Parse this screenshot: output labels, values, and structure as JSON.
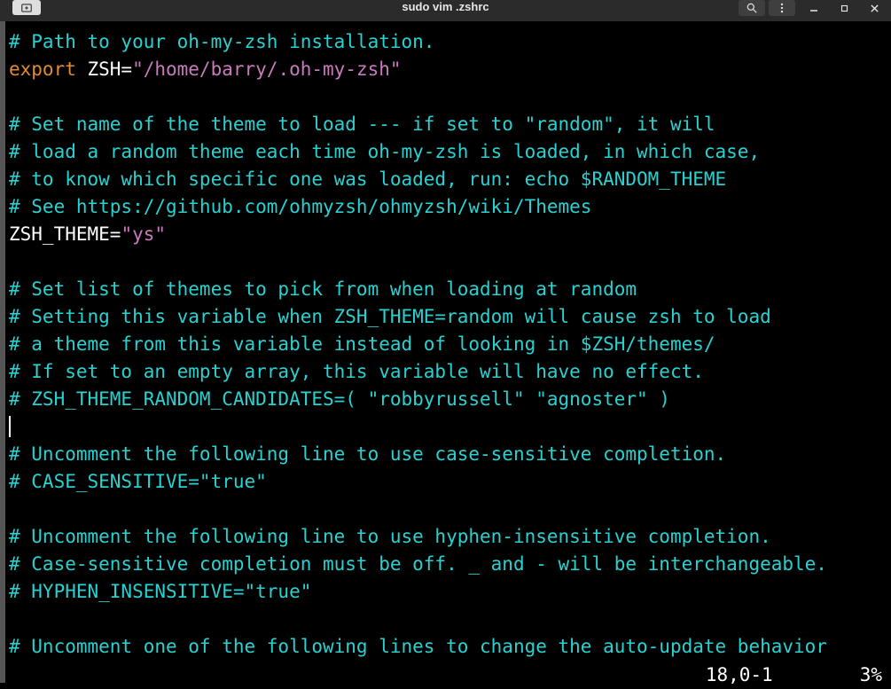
{
  "titlebar": {
    "title": "sudo vim .zshrc"
  },
  "editor": {
    "lines": [
      {
        "segments": [
          {
            "cls": "comment",
            "text": "# Path to your oh-my-zsh installation."
          }
        ]
      },
      {
        "segments": [
          {
            "cls": "keyword",
            "text": "export"
          },
          {
            "cls": "plain",
            "text": " ZSH="
          },
          {
            "cls": "string",
            "text": "\"/home/barry/.oh-my-zsh\""
          }
        ]
      },
      {
        "segments": []
      },
      {
        "segments": [
          {
            "cls": "comment",
            "text": "# Set name of the theme to load --- if set to \"random\", it will"
          }
        ]
      },
      {
        "segments": [
          {
            "cls": "comment",
            "text": "# load a random theme each time oh-my-zsh is loaded, in which case,"
          }
        ]
      },
      {
        "segments": [
          {
            "cls": "comment",
            "text": "# to know which specific one was loaded, run: echo $RANDOM_THEME"
          }
        ]
      },
      {
        "segments": [
          {
            "cls": "comment",
            "text": "# See https://github.com/ohmyzsh/ohmyzsh/wiki/Themes"
          }
        ]
      },
      {
        "segments": [
          {
            "cls": "plain",
            "text": "ZSH_THEME="
          },
          {
            "cls": "string",
            "text": "\"ys\""
          }
        ]
      },
      {
        "segments": []
      },
      {
        "segments": [
          {
            "cls": "comment",
            "text": "# Set list of themes to pick from when loading at random"
          }
        ]
      },
      {
        "segments": [
          {
            "cls": "comment",
            "text": "# Setting this variable when ZSH_THEME=random will cause zsh to load"
          }
        ]
      },
      {
        "segments": [
          {
            "cls": "comment",
            "text": "# a theme from this variable instead of looking in $ZSH/themes/"
          }
        ]
      },
      {
        "segments": [
          {
            "cls": "comment",
            "text": "# If set to an empty array, this variable will have no effect."
          }
        ]
      },
      {
        "segments": [
          {
            "cls": "comment",
            "text": "# ZSH_THEME_RANDOM_CANDIDATES=( \"robbyrussell\" \"agnoster\" )"
          }
        ]
      },
      {
        "segments": [],
        "cursor": true
      },
      {
        "segments": [
          {
            "cls": "comment",
            "text": "# Uncomment the following line to use case-sensitive completion."
          }
        ]
      },
      {
        "segments": [
          {
            "cls": "comment",
            "text": "# CASE_SENSITIVE=\"true\""
          }
        ]
      },
      {
        "segments": []
      },
      {
        "segments": [
          {
            "cls": "comment",
            "text": "# Uncomment the following line to use hyphen-insensitive completion."
          }
        ]
      },
      {
        "segments": [
          {
            "cls": "comment",
            "text": "# Case-sensitive completion must be off. _ and - will be interchangeable."
          }
        ]
      },
      {
        "segments": [
          {
            "cls": "comment",
            "text": "# HYPHEN_INSENSITIVE=\"true\""
          }
        ]
      },
      {
        "segments": []
      },
      {
        "segments": [
          {
            "cls": "comment",
            "text": "# Uncomment one of the following lines to change the auto-update behavior"
          }
        ]
      }
    ]
  },
  "status": {
    "position": "18,0-1",
    "percent": "3%"
  }
}
